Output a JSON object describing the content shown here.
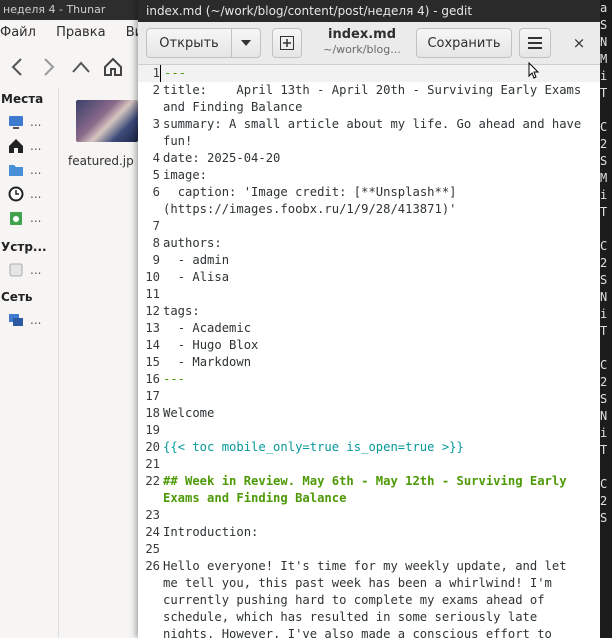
{
  "thunar": {
    "title": "неделя 4 - Thunar",
    "menu": [
      "Файл",
      "Правка",
      "Вид"
    ],
    "sidebar": {
      "places_label": "Места",
      "devices_label": "Устр...",
      "network_label": "Сеть",
      "ellipsis": "..."
    },
    "file_name": "featured.jp"
  },
  "gedit": {
    "window_title": "index.md (~/work/blog/content/post/неделя 4) - gedit",
    "open_label": "Открыть",
    "doc_title": "index.md",
    "doc_path": "~/work/blog...",
    "save_label": "Сохранить",
    "close_glyph": "×",
    "lines": [
      {
        "n": "1",
        "text": "---"
      },
      {
        "n": "2",
        "text": "title:    April 13th - April 20th - Surviving Early Exams and Finding Balance"
      },
      {
        "n": "3",
        "text": "summary: A small article about my life. Go ahead and have fun!"
      },
      {
        "n": "4",
        "text": "date: 2025-04-20"
      },
      {
        "n": "5",
        "text": "image:"
      },
      {
        "n": "6",
        "text": "  caption: 'Image credit: [**Unsplash**](https://images.foobx.ru/1/9/28/413871)'"
      },
      {
        "n": "7",
        "text": ""
      },
      {
        "n": "8",
        "text": "authors:"
      },
      {
        "n": "9",
        "text": "  - admin"
      },
      {
        "n": "10",
        "text": "  - Alisa"
      },
      {
        "n": "11",
        "text": ""
      },
      {
        "n": "12",
        "text": "tags:"
      },
      {
        "n": "13",
        "text": "  - Academic"
      },
      {
        "n": "14",
        "text": "  - Hugo Blox"
      },
      {
        "n": "15",
        "text": "  - Markdown"
      },
      {
        "n": "16",
        "text": "---"
      },
      {
        "n": "17",
        "text": ""
      },
      {
        "n": "18",
        "text": "Welcome"
      },
      {
        "n": "19",
        "text": ""
      },
      {
        "n": "20",
        "text": "{{< toc mobile_only=true is_open=true >}}"
      },
      {
        "n": "21",
        "text": ""
      },
      {
        "n": "22",
        "text": "## Week in Review. May 6th - May 12th - Surviving Early Exams and Finding Balance"
      },
      {
        "n": "23",
        "text": ""
      },
      {
        "n": "24",
        "text": "Introduction:"
      },
      {
        "n": "25",
        "text": ""
      },
      {
        "n": "26",
        "text": "Hello everyone! It's time for my weekly update, and let me tell you, this past week has been a whirlwind! I'm currently pushing hard to complete my exams ahead of schedule, which has resulted in some seriously late nights. However, I've also made a conscious effort to"
      }
    ]
  },
  "terminal_fragments": [
    "a",
    "S",
    "N",
    "M",
    "i",
    "T",
    "",
    "C",
    "2",
    "S",
    "M",
    "i",
    "T",
    "",
    "C",
    "2",
    "S",
    "N",
    "i",
    "T",
    "",
    "C",
    "2",
    "S",
    "N",
    "i",
    "T",
    "",
    "C",
    "2",
    "S"
  ]
}
